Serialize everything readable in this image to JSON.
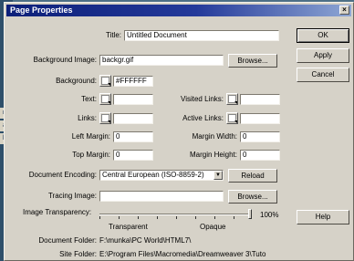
{
  "window": {
    "title": "Page Properties",
    "close_glyph": "×"
  },
  "desktop": {
    "items": [
      "n",
      "a",
      "b"
    ]
  },
  "fields": {
    "title_label": "Title:",
    "title_value": "Untitled Document",
    "bg_image_label": "Background Image:",
    "bg_image_value": "backgr.gif",
    "background_label": "Background:",
    "background_value": "#FFFFFF",
    "text_label": "Text:",
    "visited_links_label": "Visited Links:",
    "links_label": "Links:",
    "active_links_label": "Active Links:",
    "left_margin_label": "Left Margin:",
    "left_margin_value": "0",
    "margin_width_label": "Margin Width:",
    "margin_width_value": "0",
    "top_margin_label": "Top Margin:",
    "top_margin_value": "0",
    "margin_height_label": "Margin Height:",
    "margin_height_value": "0",
    "doc_encoding_label": "Document Encoding:",
    "doc_encoding_value": "Central European (ISO-8859-2)",
    "tracing_image_label": "Tracing Image:",
    "tracing_image_value": "",
    "transparency_label": "Image Transparency:",
    "transparency_percent": "100%",
    "transparency_level": 1.0,
    "transparent_label": "Transparent",
    "opaque_label": "Opaque",
    "doc_folder_label": "Document Folder:",
    "doc_folder_value": "F:\\munka\\PC World\\HTML7\\",
    "site_folder_label": "Site Folder:",
    "site_folder_value": "E:\\Program Files\\Macromedia\\Dreamweaver 3\\Tuto"
  },
  "buttons": {
    "browse1": "Browse...",
    "reload": "Reload",
    "browse2": "Browse...",
    "ok": "OK",
    "apply": "Apply",
    "cancel": "Cancel",
    "help": "Help"
  },
  "colors": {
    "title_bar": "#0c1f79",
    "dialog_bg": "#d6d2c8"
  }
}
